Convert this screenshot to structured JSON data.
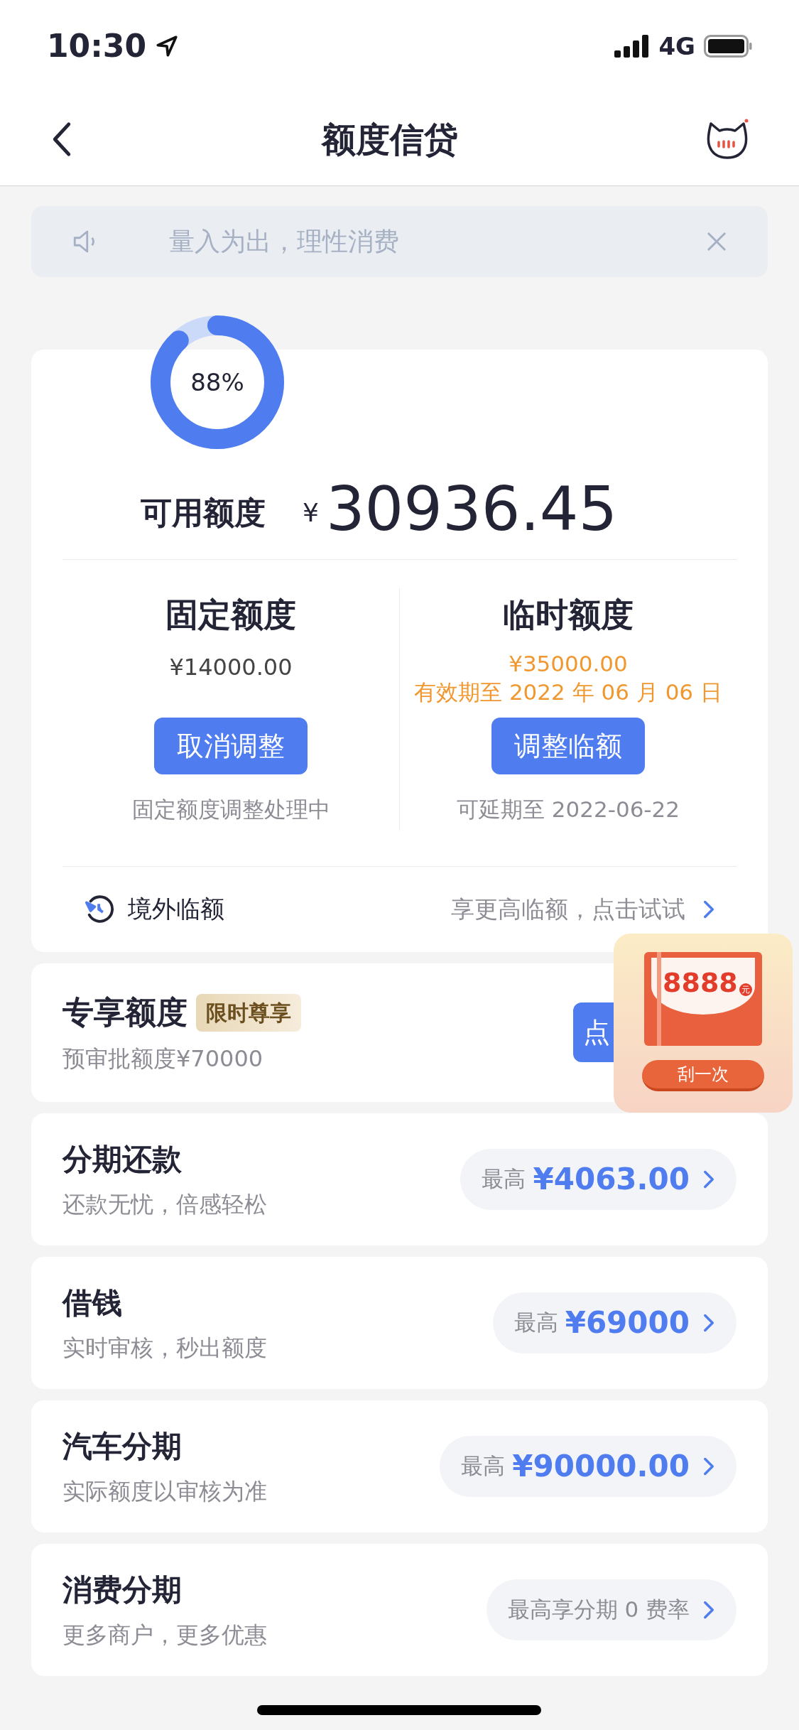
{
  "status_bar": {
    "time": "10:30",
    "network": "4G"
  },
  "nav": {
    "title": "额度信贷"
  },
  "notice": {
    "text": "量入为出，理性消费"
  },
  "credit": {
    "ring_label": "88%",
    "level": 0.88,
    "label": "可用额度",
    "currency": "¥",
    "amount": "30936.45",
    "columns": [
      {
        "title": "固定额度",
        "lines": [
          {
            "text": "¥14000.00",
            "kind": "plain"
          }
        ],
        "button": "取消调整",
        "note": "固定额度调整处理中"
      },
      {
        "title": "临时额度",
        "lines": [
          {
            "text": "¥35000.00",
            "kind": "highlight"
          },
          {
            "text": "有效期至 2022 年 06 月 06 日",
            "kind": "highlight"
          }
        ],
        "button": "调整临额",
        "note": "可延期至 2022-06-22"
      }
    ],
    "overseas": {
      "label": "境外临额",
      "hint": "享更高临额，点击试试"
    }
  },
  "exclusive": {
    "title": "专享额度",
    "tag": "限时尊享",
    "subtitle": "预审批额度¥70000",
    "button": "点"
  },
  "scratch": {
    "amount": "8888",
    "unit": "元",
    "button": "刮一次"
  },
  "products": [
    {
      "title": "分期还款",
      "subtitle": "还款无忧，倍感轻松",
      "prefix": "最高",
      "value": "¥4063.00",
      "kind": "amount"
    },
    {
      "title": "借钱",
      "subtitle": "实时审核，秒出额度",
      "prefix": "最高",
      "value": "¥69000",
      "kind": "amount"
    },
    {
      "title": "汽车分期",
      "subtitle": "实际额度以审核为准",
      "prefix": "最高",
      "value": "¥90000.00",
      "kind": "amount"
    },
    {
      "title": "消费分期",
      "subtitle": "更多商户，更多优惠",
      "prefix": "最高享分期 0 费率",
      "kind": "text"
    }
  ]
}
